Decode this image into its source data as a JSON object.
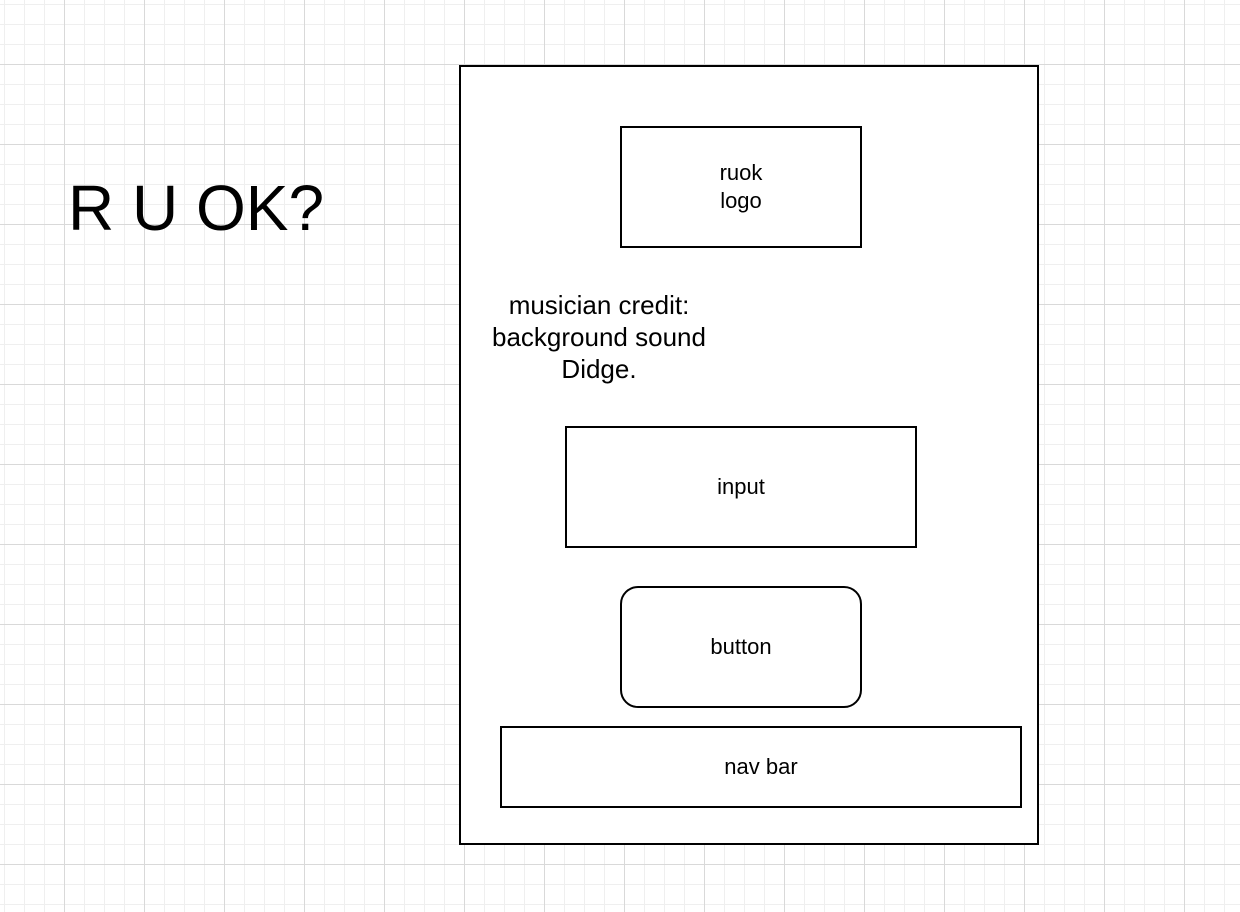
{
  "title": "R U OK?",
  "wireframe": {
    "logo": {
      "line1": "ruok",
      "line2": "logo"
    },
    "credit": {
      "line1": "musician credit:",
      "line2": "background sound",
      "line3": "Didge."
    },
    "input_label": "input",
    "button_label": "button",
    "nav_label": "nav bar"
  }
}
